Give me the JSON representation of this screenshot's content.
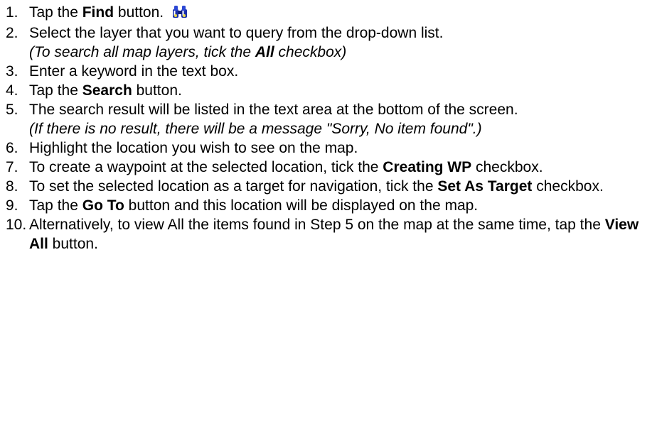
{
  "steps": [
    {
      "num": "1.",
      "t1": "Tap the ",
      "b1": "Find",
      "t2": " button. "
    },
    {
      "num": "2.",
      "t1": "Select the layer that you want to query from the drop-down list.",
      "note_a": "(To search all map layers, tick the ",
      "note_b": "All",
      "note_c": " checkbox)"
    },
    {
      "num": "3.",
      "t1": "Enter a keyword in the text box."
    },
    {
      "num": "4.",
      "t1": "Tap the ",
      "b1": "Search",
      "t2": " button."
    },
    {
      "num": "5.",
      "t1": "The search result will be listed in the text area at the bottom of the screen.",
      "note": "(If there is no result, there will be a message \"Sorry, No item found\".)"
    },
    {
      "num": "6.",
      "t1": "Highlight the location you wish to see on the map."
    },
    {
      "num": "7.",
      "t1": "To create a waypoint at the selected location, tick the ",
      "b1": "Creating WP",
      "t2": " checkbox."
    },
    {
      "num": "8.",
      "t1": "To set the selected location as a target for navigation, tick the ",
      "b1": "Set As Target",
      "t2": " checkbox."
    },
    {
      "num": "9.",
      "t1": "Tap the ",
      "b1": "Go To",
      "t2": " button and this location will be displayed on the map."
    },
    {
      "num": "10.",
      "t1": "Alternatively, to view All the items found in Step 5 on the map at the same time, tap the ",
      "b1": "View All",
      "t2": " button."
    }
  ],
  "icons": {
    "find": "binoculars-icon",
    "find_color": "#1a2fa8"
  }
}
